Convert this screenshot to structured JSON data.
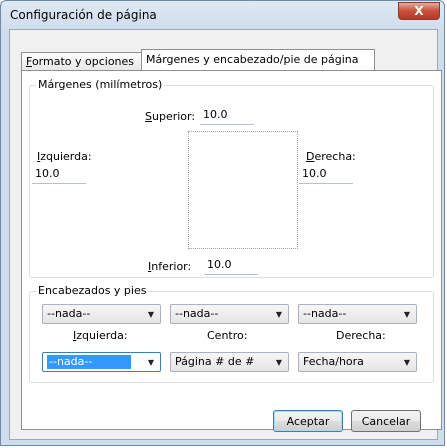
{
  "window": {
    "title": "Configuración de página",
    "close_label": "X"
  },
  "tabs": [
    {
      "label": "Formato y opciones",
      "active": false
    },
    {
      "label": "Márgenes y encabezado/pie de página",
      "active": true
    }
  ],
  "margins": {
    "group_label": "Márgenes (milímetros)",
    "top_label": "Superior:",
    "top_value": "10.0",
    "left_label": "Izquierda:",
    "left_value": "10.0",
    "right_label": "Derecha:",
    "right_value": "10.0",
    "bottom_label": "Inferior:",
    "bottom_value": "10.0"
  },
  "headers": {
    "group_label": "Encabezados y pies",
    "header_left": "--nada--",
    "header_center": "--nada--",
    "header_right": "--nada--",
    "left_label": "Izquierda:",
    "center_label": "Centro:",
    "right_label": "Derecha:",
    "footer_left": "--nada--",
    "footer_center": "Página # de #",
    "footer_right": "Fecha/hora"
  },
  "buttons": {
    "ok": "Aceptar",
    "cancel": "Cancelar"
  },
  "colors": {
    "selection": "#3399ff",
    "close_button": "#c8503b"
  }
}
